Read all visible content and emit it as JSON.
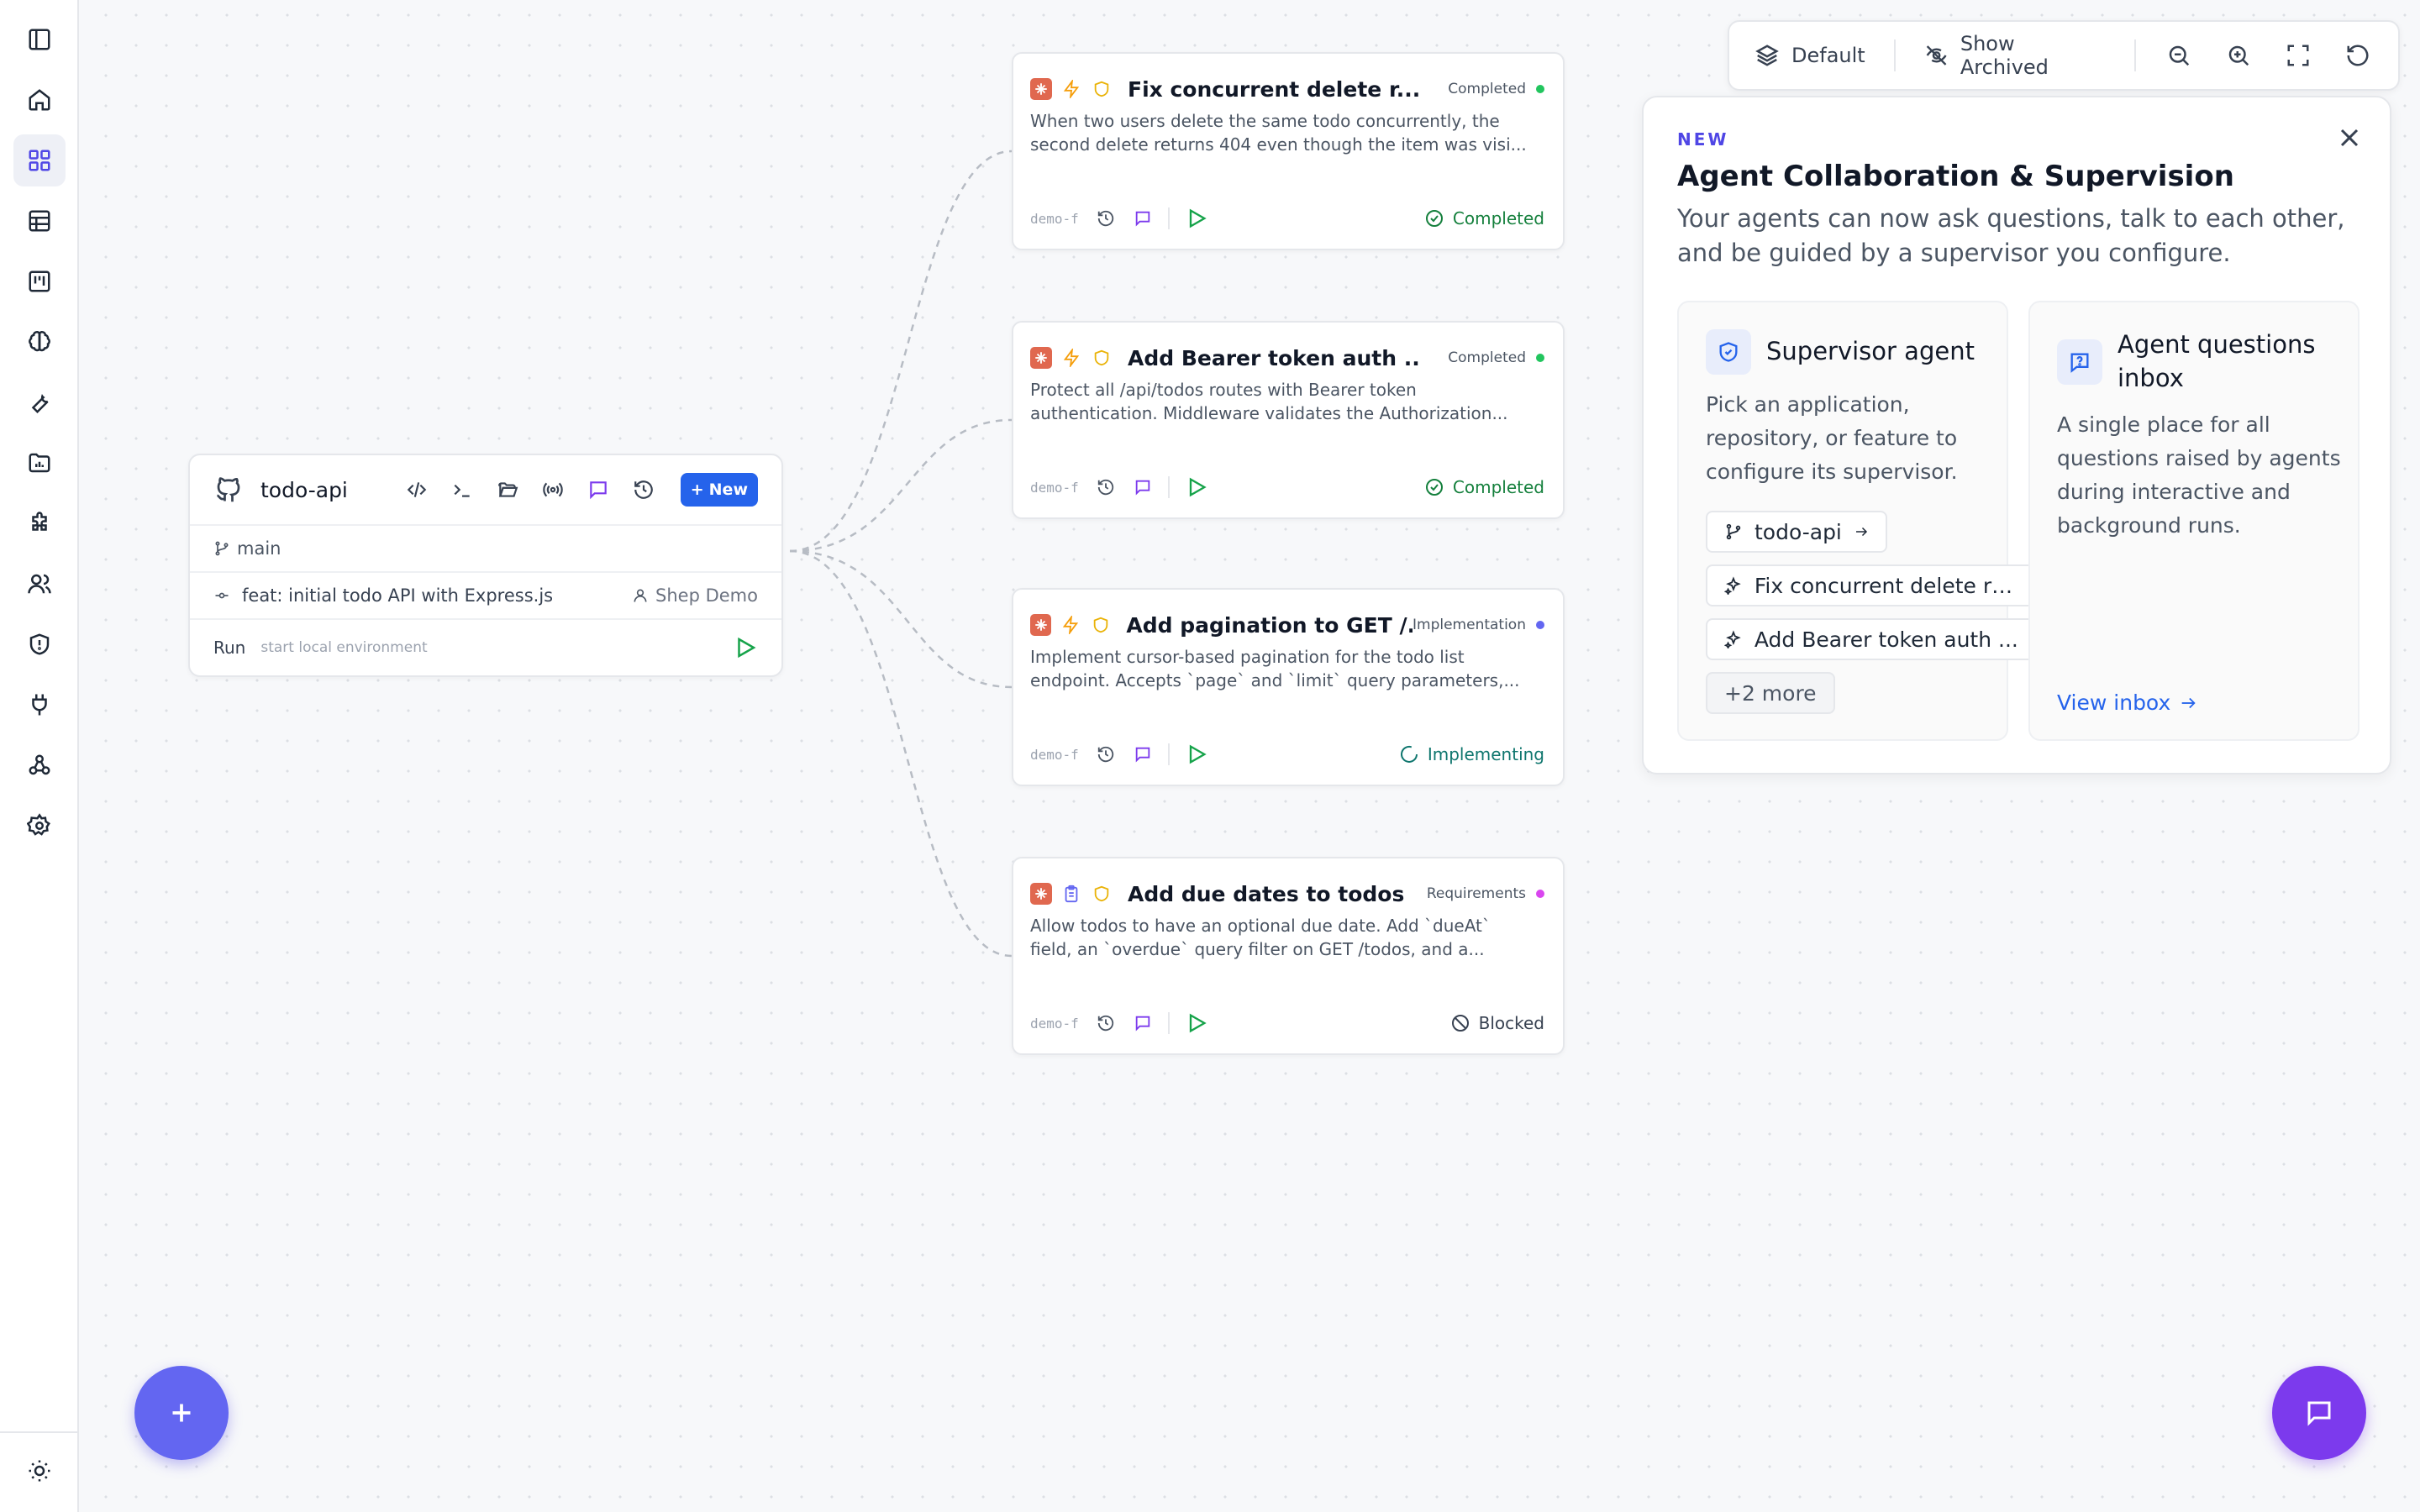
{
  "sidebar": {
    "items": [
      {
        "icon": "sidebar-toggle-icon"
      },
      {
        "icon": "home-icon"
      },
      {
        "icon": "dashboard-icon",
        "active": true
      },
      {
        "icon": "table-icon"
      },
      {
        "icon": "kanban-icon"
      },
      {
        "icon": "brain-icon"
      },
      {
        "icon": "wrench-icon"
      },
      {
        "icon": "folder-chart-icon"
      },
      {
        "icon": "puzzle-icon"
      },
      {
        "icon": "users-icon"
      },
      {
        "icon": "shield-icon"
      },
      {
        "icon": "plug-icon"
      },
      {
        "icon": "webhook-icon"
      },
      {
        "icon": "settings-icon"
      }
    ],
    "theme_icon": "sun-icon"
  },
  "toolbar": {
    "layout_label": "Default",
    "archived_label": "Show Archived",
    "icons": [
      "zoom-out-icon",
      "zoom-in-icon",
      "fullscreen-icon",
      "reset-icon"
    ]
  },
  "repo": {
    "name": "todo-api",
    "new_label": "New",
    "branch": "main",
    "commit": "feat: initial todo API with Express.js",
    "author": "Shep Demo",
    "run_label": "Run",
    "run_hint": "start local environment"
  },
  "features": [
    {
      "title": "Fix concurrent delete r...",
      "state": "Completed",
      "state_color": "#22c55e",
      "desc1": "When two users delete the same todo concurrently, the",
      "desc2": "second delete returns 404 even though the item was visi...",
      "branch": "demo-f",
      "status": "Completed",
      "status_color": "#15803d"
    },
    {
      "title": "Add Bearer token auth ...",
      "state": "Completed",
      "state_color": "#22c55e",
      "desc1": "Protect all /api/todos routes with Bearer token",
      "desc2": "authentication. Middleware validates the Authorization...",
      "branch": "demo-f",
      "status": "Completed",
      "status_color": "#15803d"
    },
    {
      "title": "Add pagination to GET /...",
      "state": "Implementation",
      "state_color": "#6366f1",
      "desc1": "Implement cursor-based pagination for the todo list",
      "desc2": "endpoint. Accepts `page` and `limit` query parameters,...",
      "branch": "demo-f",
      "status": "Implementing",
      "status_color": "#0f766e"
    },
    {
      "title": "Add due dates to todos",
      "state": "Requirements",
      "state_color": "#d946ef",
      "desc1": "Allow todos to have an optional due date. Add `dueAt`",
      "desc2": "field, an `overdue` query filter on GET /todos, and a...",
      "branch": "demo-f",
      "status": "Blocked",
      "status_color": "#374151"
    }
  ],
  "panel": {
    "tag": "NEW",
    "title": "Agent Collaboration & Supervision",
    "subtitle": "Your agents can now ask questions, talk to each other, and be guided by a supervisor you configure.",
    "supervisor": {
      "title": "Supervisor agent",
      "text": "Pick an application, repository, or feature to configure its supervisor.",
      "chips": [
        "todo-api",
        "Fix concurrent delete ra...",
        "Add Bearer token auth ..."
      ],
      "more": "+2 more"
    },
    "inbox": {
      "title": "Agent questions inbox",
      "text": "A single place for all questions raised by agents during interactive and background runs.",
      "link": "View inbox"
    }
  }
}
